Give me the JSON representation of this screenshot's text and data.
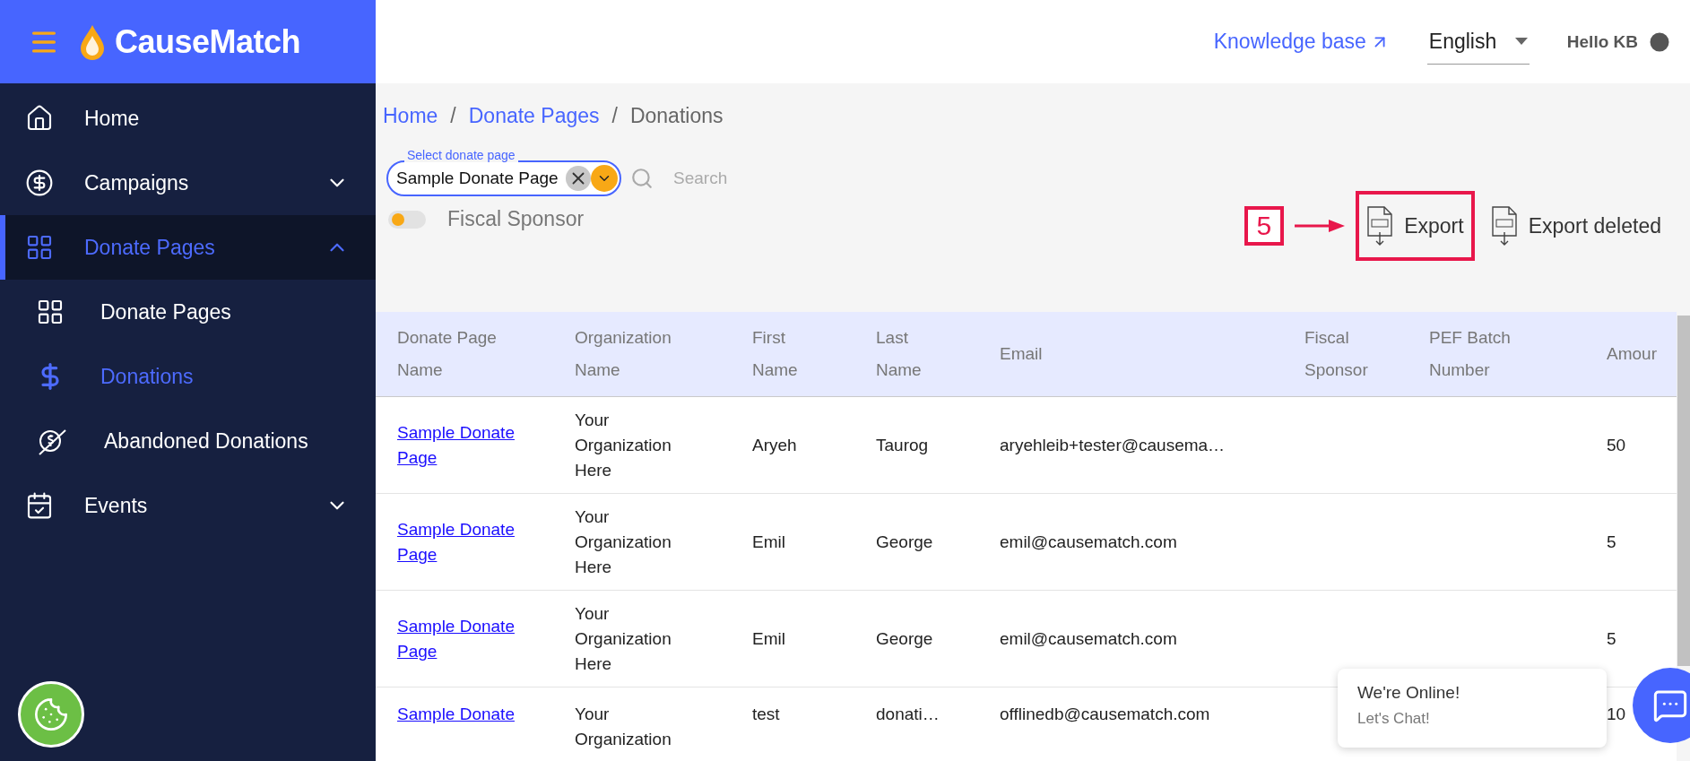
{
  "brand": {
    "name": "CauseMatch"
  },
  "nav": [
    {
      "label": "Home",
      "kind": "home",
      "selected": false
    },
    {
      "label": "Campaigns",
      "kind": "money",
      "selected": false,
      "expanded": false
    },
    {
      "label": "Donate Pages",
      "kind": "pages",
      "selected": true,
      "expanded": true,
      "children": [
        {
          "label": "Donate Pages",
          "kind": "pages",
          "selected": false
        },
        {
          "label": "Donations",
          "kind": "donations",
          "selected": true
        },
        {
          "label": "Abandoned Donations",
          "kind": "abandoned",
          "selected": false
        }
      ]
    },
    {
      "label": "Events",
      "kind": "events",
      "selected": false,
      "expanded": false
    }
  ],
  "topbar": {
    "knowledge_base": "Knowledge base",
    "language": "English",
    "greeting": "Hello KB"
  },
  "breadcrumb": [
    {
      "label": "Home",
      "link": true
    },
    {
      "label": "Donate Pages",
      "link": true
    },
    {
      "label": "Donations",
      "link": false
    }
  ],
  "breadcrumb_separator": "/",
  "filters": {
    "select": {
      "label": "Select donate page",
      "value": "Sample Donate Page"
    },
    "search": {
      "placeholder": "Search"
    },
    "fiscal_sponsor": {
      "label": "Fiscal Sponsor",
      "on": false
    }
  },
  "annotation": {
    "step": "5"
  },
  "actions": [
    {
      "label": "Export",
      "highlighted": true
    },
    {
      "label": "Export deleted",
      "highlighted": false
    }
  ],
  "table": {
    "columns": [
      "Donate Page\nName",
      "Organization\nName",
      "First\nName",
      "Last\nName",
      "Email",
      "Fiscal\nSponsor",
      "PEF Batch\nNumber",
      "Amour"
    ],
    "rows": [
      [
        "Sample Donate Page",
        "Your Organization Here",
        "Aryeh",
        "Taurog",
        "aryehleib+tester@causema…",
        "",
        "",
        "50"
      ],
      [
        "Sample Donate Page",
        "Your Organization Here",
        "Emil",
        "George",
        "emil@causematch.com",
        "",
        "",
        "5"
      ],
      [
        "Sample Donate Page",
        "Your Organization Here",
        "Emil",
        "George",
        "emil@causematch.com",
        "",
        "",
        "5"
      ],
      [
        "Sample Donate",
        "Your Organization",
        "test",
        "donati…",
        "offlinedb@causematch.com",
        "",
        "",
        "10"
      ]
    ]
  },
  "chat": {
    "title": "We're Online!",
    "subtitle": "Let's Chat!"
  }
}
